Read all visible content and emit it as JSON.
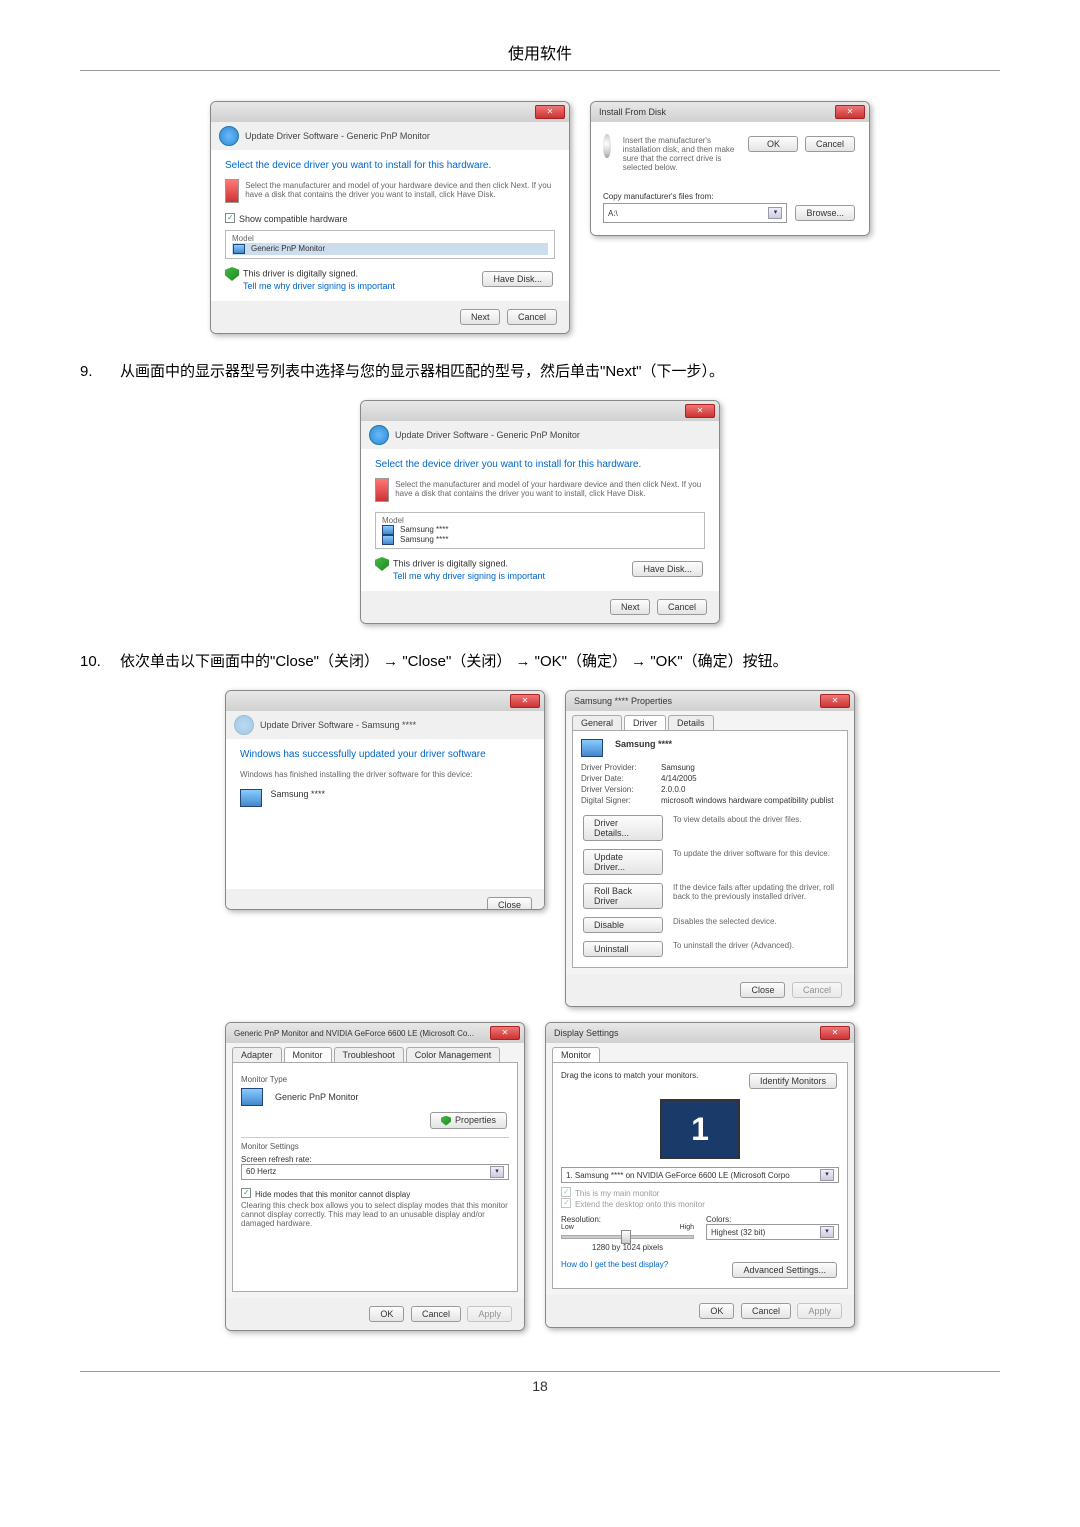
{
  "header": "使用软件",
  "page_number": "18",
  "step9": {
    "num": "9.",
    "text": "从画面中的显示器型号列表中选择与您的显示器相匹配的型号，然后单击\"Next\"（下一步）。"
  },
  "step10": {
    "num": "10.",
    "text": "依次单击以下画面中的\"Close\"（关闭） → \"Close\"（关闭） → \"OK\"（确定） → \"OK\"（确定）按钮。"
  },
  "dlg1": {
    "nav": "Update Driver Software - Generic PnP Monitor",
    "heading": "Select the device driver you want to install for this hardware.",
    "desc": "Select the manufacturer and model of your hardware device and then click Next. If you have a disk that contains the driver you want to install, click Have Disk.",
    "show_compat": "Show compatible hardware",
    "model_hdr": "Model",
    "model_item": "Generic PnP Monitor",
    "signed": "This driver is digitally signed.",
    "tell_me": "Tell me why driver signing is important",
    "have_disk": "Have Disk...",
    "next": "Next",
    "cancel": "Cancel"
  },
  "dlg2": {
    "title": "Install From Disk",
    "msg": "Insert the manufacturer's installation disk, and then make sure that the correct drive is selected below.",
    "ok": "OK",
    "cancel": "Cancel",
    "copy_label": "Copy manufacturer's files from:",
    "drive": "A:\\",
    "browse": "Browse..."
  },
  "dlg3": {
    "nav": "Update Driver Software - Generic PnP Monitor",
    "heading": "Select the device driver you want to install for this hardware.",
    "desc": "Select the manufacturer and model of your hardware device and then click Next. If you have a disk that contains the driver you want to install, click Have Disk.",
    "model_hdr": "Model",
    "item1": "Samsung ****",
    "item2": "Samsung ****",
    "signed": "This driver is digitally signed.",
    "tell_me": "Tell me why driver signing is important",
    "have_disk": "Have Disk...",
    "next": "Next",
    "cancel": "Cancel"
  },
  "dlg4": {
    "nav": "Update Driver Software - Samsung ****",
    "heading": "Windows has successfully updated your driver software",
    "desc": "Windows has finished installing the driver software for this device:",
    "device": "Samsung ****",
    "close": "Close"
  },
  "dlg5": {
    "title": "Samsung **** Properties",
    "tab_general": "General",
    "tab_driver": "Driver",
    "tab_details": "Details",
    "device": "Samsung ****",
    "provider_l": "Driver Provider:",
    "provider_v": "Samsung",
    "date_l": "Driver Date:",
    "date_v": "4/14/2005",
    "version_l": "Driver Version:",
    "version_v": "2.0.0.0",
    "signer_l": "Digital Signer:",
    "signer_v": "microsoft windows hardware compatibility publist",
    "btn_details": "Driver Details...",
    "btn_details_d": "To view details about the driver files.",
    "btn_update": "Update Driver...",
    "btn_update_d": "To update the driver software for this device.",
    "btn_rollback": "Roll Back Driver",
    "btn_rollback_d": "If the device fails after updating the driver, roll back to the previously installed driver.",
    "btn_disable": "Disable",
    "btn_disable_d": "Disables the selected device.",
    "btn_uninstall": "Uninstall",
    "btn_uninstall_d": "To uninstall the driver (Advanced).",
    "close": "Close",
    "cancel": "Cancel"
  },
  "dlg6": {
    "title": "Generic PnP Monitor and NVIDIA GeForce 6600 LE (Microsoft Co...",
    "tab_adapter": "Adapter",
    "tab_monitor": "Monitor",
    "tab_trouble": "Troubleshoot",
    "tab_color": "Color Management",
    "type_hdr": "Monitor Type",
    "type_val": "Generic PnP Monitor",
    "properties": "Properties",
    "settings_hdr": "Monitor Settings",
    "refresh_l": "Screen refresh rate:",
    "refresh_v": "60 Hertz",
    "hide_modes": "Hide modes that this monitor cannot display",
    "hide_desc": "Clearing this check box allows you to select display modes that this monitor cannot display correctly. This may lead to an unusable display and/or damaged hardware.",
    "ok": "OK",
    "cancel": "Cancel",
    "apply": "Apply"
  },
  "dlg7": {
    "title": "Display Settings",
    "tab_monitor": "Monitor",
    "drag": "Drag the icons to match your monitors.",
    "identify": "Identify Monitors",
    "monitor_num": "1",
    "sel_monitor": "1. Samsung **** on NVIDIA GeForce 6600 LE (Microsoft Corpo",
    "main_mon": "This is my main monitor",
    "extend": "Extend the desktop onto this monitor",
    "res_l": "Resolution:",
    "res_low": "Low",
    "res_high": "High",
    "res_val": "1280 by 1024 pixels",
    "colors_l": "Colors:",
    "colors_v": "Highest (32 bit)",
    "best_disp": "How do I get the best display?",
    "advanced": "Advanced Settings...",
    "ok": "OK",
    "cancel": "Cancel",
    "apply": "Apply"
  }
}
